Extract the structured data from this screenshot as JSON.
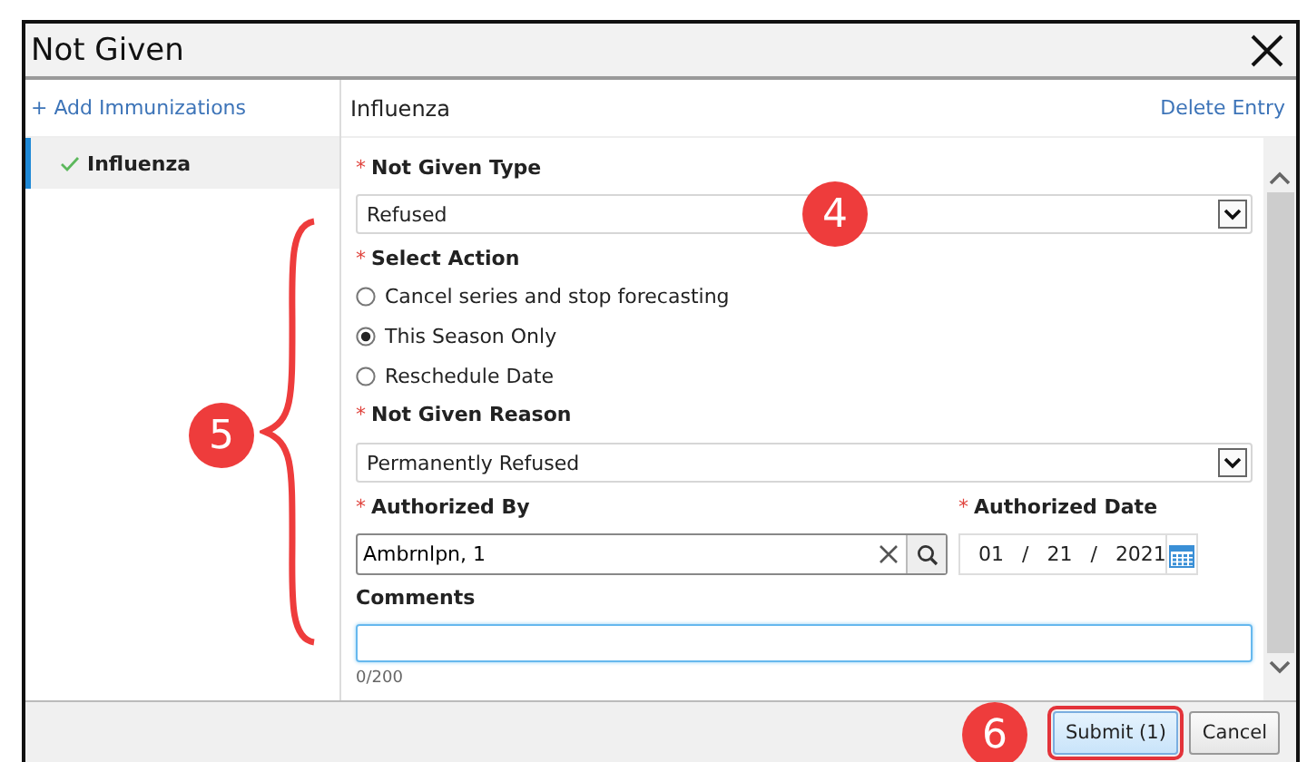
{
  "window": {
    "title": "Not Given"
  },
  "sidebar": {
    "add_link": "+ Add Immunizations",
    "items": [
      {
        "label": "Influenza",
        "selected": true,
        "complete": true
      }
    ]
  },
  "entry_header": {
    "title": "Influenza",
    "delete_link": "Delete Entry"
  },
  "form": {
    "not_given_type": {
      "label": "Not Given Type",
      "required_mark": "*",
      "value": "Refused"
    },
    "select_action": {
      "label": "Select Action",
      "required_mark": "*",
      "options": [
        {
          "label": "Cancel series and stop forecasting",
          "selected": false
        },
        {
          "label": "This Season Only",
          "selected": true
        },
        {
          "label": "Reschedule Date",
          "selected": false
        }
      ]
    },
    "not_given_reason": {
      "label": "Not Given Reason",
      "required_mark": "*",
      "value": "Permanently Refused"
    },
    "authorized_by": {
      "label": "Authorized By",
      "required_mark": "*",
      "value": "Ambrnlpn, 1"
    },
    "authorized_date": {
      "label": "Authorized Date",
      "required_mark": "*",
      "month": "01",
      "day": "21",
      "year": "2021",
      "separator": "/"
    },
    "comments": {
      "label": "Comments",
      "focused": true,
      "counter": "0/200"
    }
  },
  "footer": {
    "buttons": [
      {
        "label": "Submit (1)",
        "kind": "primary",
        "highlighted": true
      },
      {
        "label": "Cancel",
        "kind": "secondary",
        "highlighted": false
      }
    ]
  },
  "callouts": [
    {
      "number": "4",
      "kind": "circle"
    },
    {
      "number": "5",
      "kind": "brace"
    },
    {
      "number": "6",
      "kind": "circle"
    }
  ]
}
